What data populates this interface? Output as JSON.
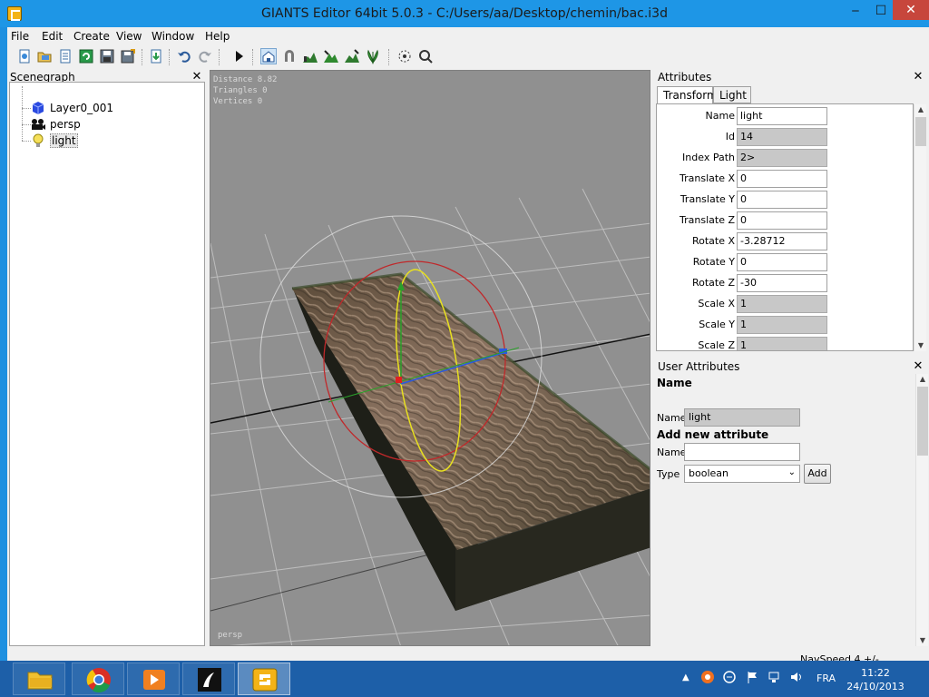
{
  "window": {
    "title": "GIANTS Editor 64bit 5.0.3 - C:/Users/aa/Desktop/chemin/bac.i3d",
    "minimize_glyph": "‒",
    "maximize_glyph": "☐",
    "close_glyph": "✕"
  },
  "menu": [
    "File",
    "Edit",
    "Create",
    "View",
    "Window",
    "Help"
  ],
  "toolbar_icons": [
    "new-icon",
    "open-icon",
    "script-icon",
    "refresh-icon",
    "save-icon",
    "save-as-icon",
    "import-icon",
    "undo-icon",
    "redo-icon",
    "play-icon",
    "home-icon",
    "magnet-icon",
    "terrain-icon",
    "terrain-paint-icon",
    "foliage-icon",
    "particles-icon",
    "select-icon"
  ],
  "scenegraph": {
    "title": "Scenegraph",
    "close_glyph": "✕",
    "nodes": [
      {
        "label": "Layer0_001",
        "icon": "cube-icon"
      },
      {
        "label": "persp",
        "icon": "camera-icon"
      },
      {
        "label": "light",
        "icon": "lightbulb-icon"
      }
    ]
  },
  "viewport": {
    "stats": [
      "Distance 8.82",
      "Triangles 0",
      "Vertices 0"
    ],
    "camera_label": "persp"
  },
  "attributes": {
    "title": "Attributes",
    "close_glyph": "✕",
    "tabs": [
      "Transform",
      "Light"
    ],
    "active_tab": "Transform",
    "fields": [
      {
        "label": "Name",
        "value": "light",
        "readonly": false
      },
      {
        "label": "Id",
        "value": "14",
        "readonly": true
      },
      {
        "label": "Index Path",
        "value": "2>",
        "readonly": true
      },
      {
        "label": "Translate X",
        "value": "0",
        "readonly": false
      },
      {
        "label": "Translate Y",
        "value": "0",
        "readonly": false
      },
      {
        "label": "Translate Z",
        "value": "0",
        "readonly": false
      },
      {
        "label": "Rotate X",
        "value": "-3.28712",
        "readonly": false
      },
      {
        "label": "Rotate Y",
        "value": "0",
        "readonly": false
      },
      {
        "label": "Rotate Z",
        "value": "-30",
        "readonly": false
      },
      {
        "label": "Scale X",
        "value": "1",
        "readonly": true
      },
      {
        "label": "Scale Y",
        "value": "1",
        "readonly": true
      },
      {
        "label": "Scale Z",
        "value": "1",
        "readonly": true
      }
    ]
  },
  "user_attributes": {
    "title": "User Attributes",
    "close_glyph": "✕",
    "name_heading": "Name",
    "name_label": "Name",
    "name_value": "light",
    "add_heading": "Add new attribute",
    "new_name_label": "Name",
    "new_name_value": "",
    "type_label": "Type",
    "type_value": "boolean",
    "add_button": "Add"
  },
  "status": {
    "navspeed": "NavSpeed 4 +/-"
  },
  "taskbar": {
    "apps": [
      "file-explorer-icon",
      "chrome-icon",
      "media-player-icon",
      "inkscape-icon",
      "giants-editor-icon"
    ],
    "active_app": "giants-editor-icon",
    "language": "FRA",
    "time": "11:22",
    "date": "24/10/2013"
  },
  "colors": {
    "titlebar": "#1e96e6",
    "close_button": "#c7463c",
    "viewport_bg": "#909090",
    "taskbar": "#1d5fa8"
  }
}
